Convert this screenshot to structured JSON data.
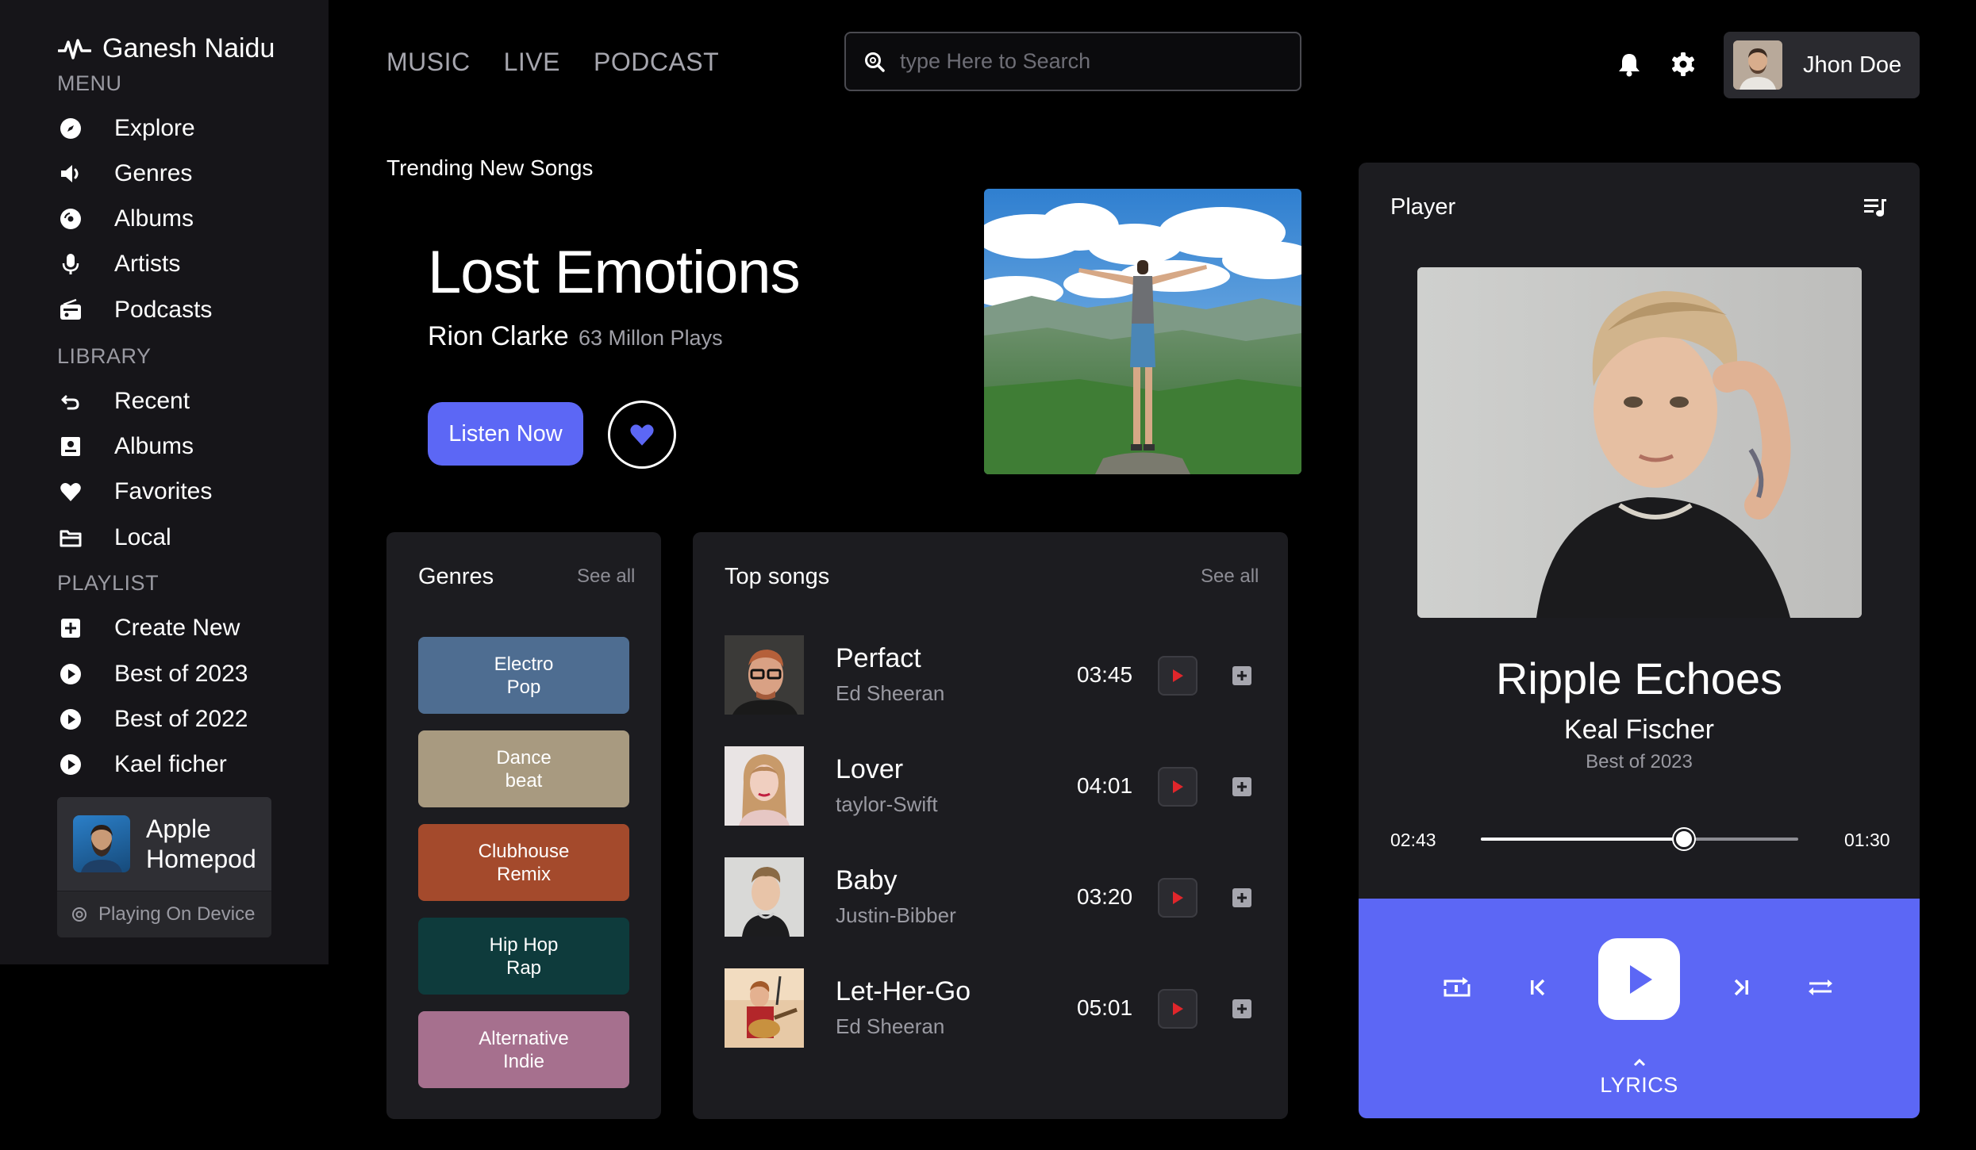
{
  "sidebar": {
    "brand": "Ganesh Naidu",
    "menu_label": "MENU",
    "menu": [
      {
        "label": "Explore",
        "icon": "compass-icon"
      },
      {
        "label": "Genres",
        "icon": "speaker-icon"
      },
      {
        "label": "Albums",
        "icon": "disc-icon"
      },
      {
        "label": "Artists",
        "icon": "microphone-icon"
      },
      {
        "label": "Podcasts",
        "icon": "radio-icon"
      }
    ],
    "library_label": "LIBRARY",
    "library": [
      {
        "label": "Recent",
        "icon": "undo-icon"
      },
      {
        "label": "Albums",
        "icon": "album-icon"
      },
      {
        "label": "Favorites",
        "icon": "heart-icon"
      },
      {
        "label": "Local",
        "icon": "folder-icon"
      }
    ],
    "playlist_label": "PLAYLIST",
    "playlist": [
      {
        "label": "Create New",
        "icon": "plus-square-icon"
      },
      {
        "label": "Best of 2023",
        "icon": "play-circle-icon"
      },
      {
        "label": "Best of 2022",
        "icon": "play-circle-icon"
      },
      {
        "label": "Kael ficher",
        "icon": "play-circle-icon"
      }
    ],
    "device": {
      "name_line1": "Apple",
      "name_line2": "Homepod",
      "status": "Playing On Device"
    }
  },
  "topnav": {
    "links": [
      "MUSIC",
      "LIVE",
      "PODCAST"
    ],
    "search_placeholder": "type Here to Search",
    "user_name": "Jhon Doe"
  },
  "hero": {
    "section_title": "Trending New Songs",
    "title": "Lost Emotions",
    "artist": "Rion Clarke",
    "plays": "63 Millon Plays",
    "listen_label": "Listen Now"
  },
  "genres": {
    "title": "Genres",
    "see_all": "See all",
    "items": [
      {
        "label": "Electro\nPop",
        "color": "#4e6d91"
      },
      {
        "label": "Dance\nbeat",
        "color": "#a89a80"
      },
      {
        "label": "Clubhouse\nRemix",
        "color": "#a44a2c"
      },
      {
        "label": "Hip Hop\nRap",
        "color": "#0e3b3c"
      },
      {
        "label": "Alternative\nIndie",
        "color": "#a6708e"
      }
    ]
  },
  "top_songs": {
    "title": "Top songs",
    "see_all": "See all",
    "items": [
      {
        "name": "Perfact",
        "artist": "Ed Sheeran",
        "duration": "03:45"
      },
      {
        "name": "Lover",
        "artist": "taylor-Swift",
        "duration": "04:01"
      },
      {
        "name": "Baby",
        "artist": "Justin-Bibber",
        "duration": "03:20"
      },
      {
        "name": "Let-Her-Go",
        "artist": "Ed Sheeran",
        "duration": "05:01"
      }
    ]
  },
  "player": {
    "title": "Player",
    "track": "Ripple Echoes",
    "artist": "Keal Fischer",
    "album": "Best of 2023",
    "elapsed": "02:43",
    "remaining": "01:30",
    "progress": 0.64,
    "lyrics_label": "LYRICS"
  },
  "colors": {
    "accent": "#5c67f5",
    "background": "#000000",
    "panel": "#1c1c20",
    "sidebar": "#161519",
    "play_red": "#e0262b"
  }
}
